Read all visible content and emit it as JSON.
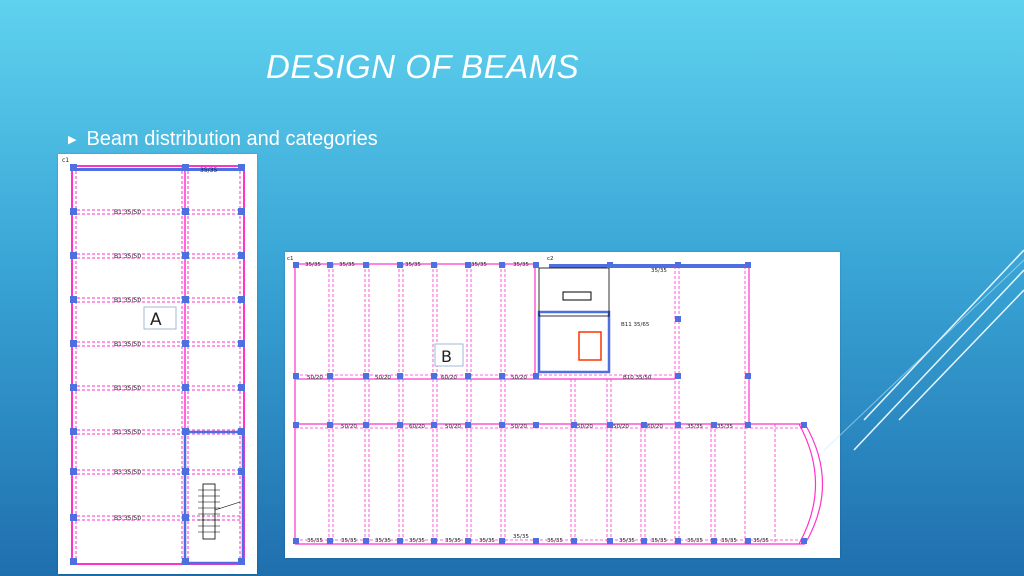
{
  "slide": {
    "title": "DESIGN OF BEAMS",
    "bullet": "Beam distribution and categories"
  },
  "plan_a": {
    "label": "A",
    "beam_labels": [
      "B1 35/50",
      "B1 35/50",
      "B1 35/50",
      "B1 35/50",
      "B1 35/50",
      "B1 35/50",
      "B3 35/50",
      "B3 35/50"
    ],
    "top_label": "35/35",
    "col_label": "c1"
  },
  "plan_b": {
    "label": "B",
    "top_labels": [
      "35/35",
      "35/35",
      "35/35",
      "35/35",
      "35/35",
      "35/35"
    ],
    "mid_labels": [
      "50/20",
      "50/20",
      "60/20",
      "50/20",
      "B10 35/50"
    ],
    "row_labels": [
      "50/20",
      "60/20",
      "50/20",
      "50/20",
      "50/20",
      "50/20",
      "60/20",
      "35/35",
      "35/35"
    ],
    "bottom_labels": [
      "35/35",
      "35/35",
      "35/35",
      "35/35",
      "35/35",
      "35/35",
      "35/35",
      "35/35",
      "35/35",
      "35/35",
      "35/35",
      "35/35",
      "35/35"
    ],
    "col_label": "c1",
    "col_label_2": "c2",
    "b11_label": "B11 35/65"
  },
  "colors": {
    "accent": "#ffffff",
    "beam": "#ff33cc",
    "column": "#4d6fe0"
  }
}
